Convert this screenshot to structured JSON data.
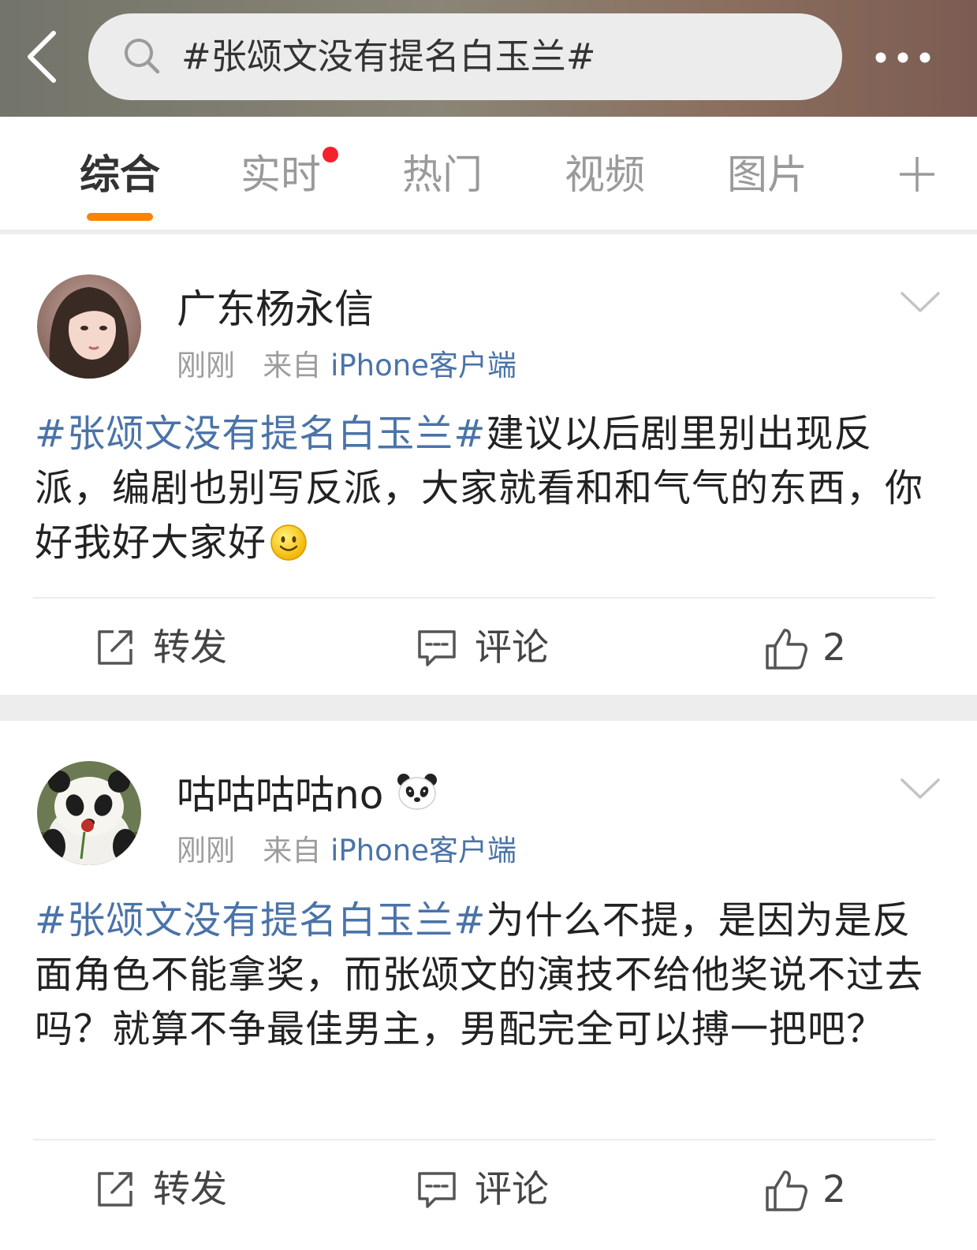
{
  "search": {
    "query": "#张颂文没有提名白玉兰#"
  },
  "tabs": [
    {
      "label": "综合",
      "active": true
    },
    {
      "label": "实时",
      "active": false,
      "has_dot": true
    },
    {
      "label": "热门",
      "active": false
    },
    {
      "label": "视频",
      "active": false
    },
    {
      "label": "图片",
      "active": false
    }
  ],
  "colors": {
    "accent": "#ff8200",
    "link": "#4a73a8",
    "notify_dot": "#f5222d"
  },
  "posts": [
    {
      "username": "广东杨永信",
      "time": "刚刚",
      "from_prefix": "来自",
      "source": "iPhone客户端",
      "topic": "#张颂文没有提名白玉兰#",
      "text": "建议以后剧里别出现反派，编剧也别写反派，大家就看和和气气的东西，你好我好大家好",
      "emoji": "smile-emoji",
      "actions": {
        "repost": "转发",
        "comment": "评论",
        "likes": "2"
      }
    },
    {
      "username": "咕咕咕咕no",
      "username_emoji": "panda-emoji",
      "time": "刚刚",
      "from_prefix": "来自",
      "source": "iPhone客户端",
      "topic": "#张颂文没有提名白玉兰#",
      "text": "为什么不提，是因为是反面角色不能拿奖，而张颂文的演技不给他奖说不过去吗？就算不争最佳男主，男配完全可以搏一把吧？",
      "actions": {
        "repost": "转发",
        "comment": "评论",
        "likes": "2"
      }
    }
  ]
}
